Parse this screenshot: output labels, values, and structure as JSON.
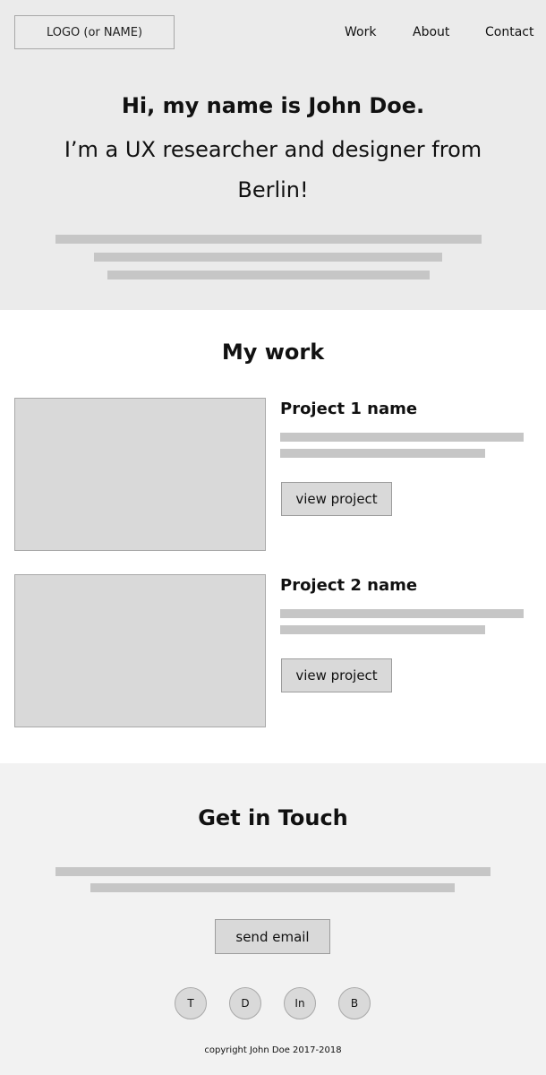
{
  "header": {
    "logo": "LOGO (or NAME)",
    "nav": [
      "Work",
      "About",
      "Contact"
    ]
  },
  "hero": {
    "title": "Hi, my name is John Doe.",
    "subtitle": "I’m a UX researcher and designer from Berlin!"
  },
  "work": {
    "title": "My work",
    "projects": [
      {
        "name": "Project 1 name",
        "button": "view project"
      },
      {
        "name": "Project 2 name",
        "button": "view project"
      }
    ]
  },
  "contact": {
    "title": "Get in Touch",
    "button": "send email",
    "social": [
      "T",
      "D",
      "In",
      "B"
    ],
    "copyright": "copyright John Doe 2017-2018"
  }
}
